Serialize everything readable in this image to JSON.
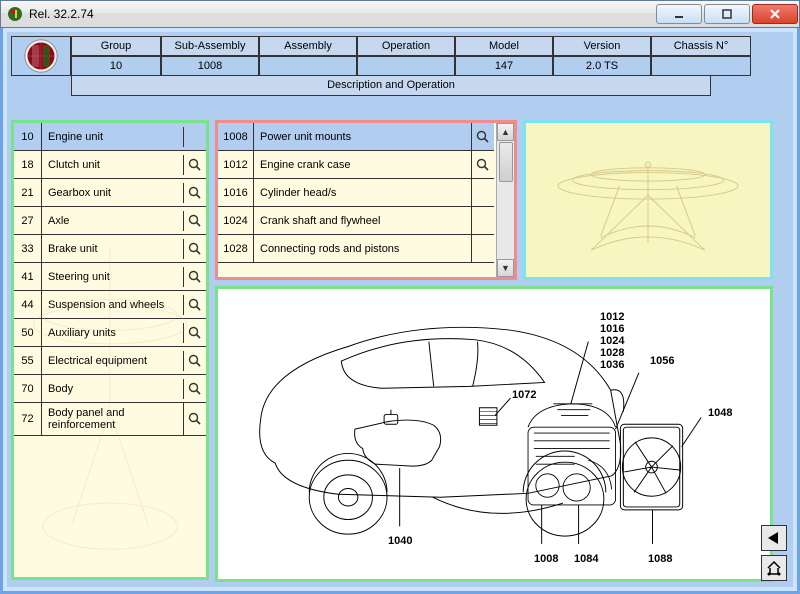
{
  "window": {
    "title": "Rel. 32.2.74"
  },
  "header": {
    "cols": [
      "Group",
      "Sub-Assembly",
      "Assembly",
      "Operation",
      "Model",
      "Version",
      "Chassis N°"
    ],
    "vals": [
      "10",
      "1008",
      "",
      "",
      "147",
      "2.0 TS",
      ""
    ],
    "description_bar": "Description and Operation"
  },
  "groups": {
    "selected": "10",
    "items": [
      {
        "code": "10",
        "label": "Engine unit"
      },
      {
        "code": "18",
        "label": "Clutch unit"
      },
      {
        "code": "21",
        "label": "Gearbox unit"
      },
      {
        "code": "27",
        "label": "Axle"
      },
      {
        "code": "33",
        "label": "Brake unit"
      },
      {
        "code": "41",
        "label": "Steering unit"
      },
      {
        "code": "44",
        "label": "Suspension and wheels"
      },
      {
        "code": "50",
        "label": "Auxiliary units"
      },
      {
        "code": "55",
        "label": "Electrical equipment"
      },
      {
        "code": "70",
        "label": "Body"
      },
      {
        "code": "72",
        "label": "Body panel and reinforcement"
      }
    ]
  },
  "subassemblies": {
    "selected": "1008",
    "items": [
      {
        "code": "1008",
        "label": "Power unit mounts"
      },
      {
        "code": "1012",
        "label": "Engine crank case"
      },
      {
        "code": "1016",
        "label": "Cylinder head/s"
      },
      {
        "code": "1024",
        "label": "Crank shaft and flywheel"
      },
      {
        "code": "1028",
        "label": "Connecting rods and pistons"
      }
    ]
  },
  "diagram_callouts": {
    "stack": [
      "1012",
      "1016",
      "1024",
      "1028",
      "1036"
    ],
    "r1056": "1056",
    "r1072": "1072",
    "r1048": "1048",
    "b1040": "1040",
    "b1008": "1008",
    "b1084": "1084",
    "b1088": "1088"
  }
}
